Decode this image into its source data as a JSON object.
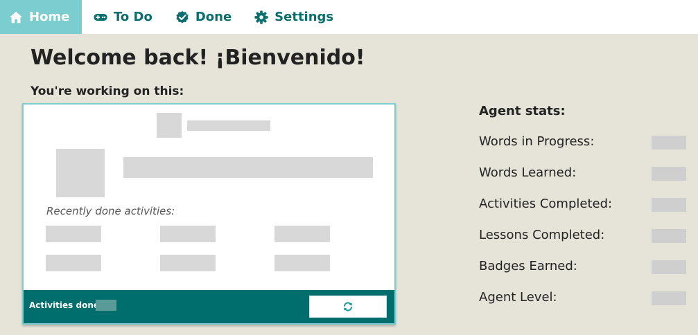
{
  "nav": {
    "items": [
      {
        "label": "Home",
        "icon": "home-icon"
      },
      {
        "label": "To Do",
        "icon": "gamepad-icon"
      },
      {
        "label": "Done",
        "icon": "check-badge-icon"
      },
      {
        "label": "Settings",
        "icon": "gear-icon"
      }
    ],
    "active": "Home"
  },
  "page": {
    "title": "Welcome back! ¡Bienvenido!",
    "subtitle": "You're working on this:"
  },
  "card": {
    "recent_label": "Recently done activities:",
    "footer": {
      "activities_done_label": "Activities done:",
      "refresh_icon": "refresh-icon"
    }
  },
  "stats": {
    "title": "Agent stats:",
    "items": [
      {
        "label": "Words in Progress:"
      },
      {
        "label": "Words Learned:"
      },
      {
        "label": "Activities Completed:"
      },
      {
        "label": "Lessons Completed:"
      },
      {
        "label": "Badges Earned:"
      },
      {
        "label": "Agent Level:"
      }
    ]
  },
  "colors": {
    "accent": "#7ccdcf",
    "brand": "#0b6e6e",
    "footer": "#006e6d",
    "background": "#e6e4d8"
  }
}
